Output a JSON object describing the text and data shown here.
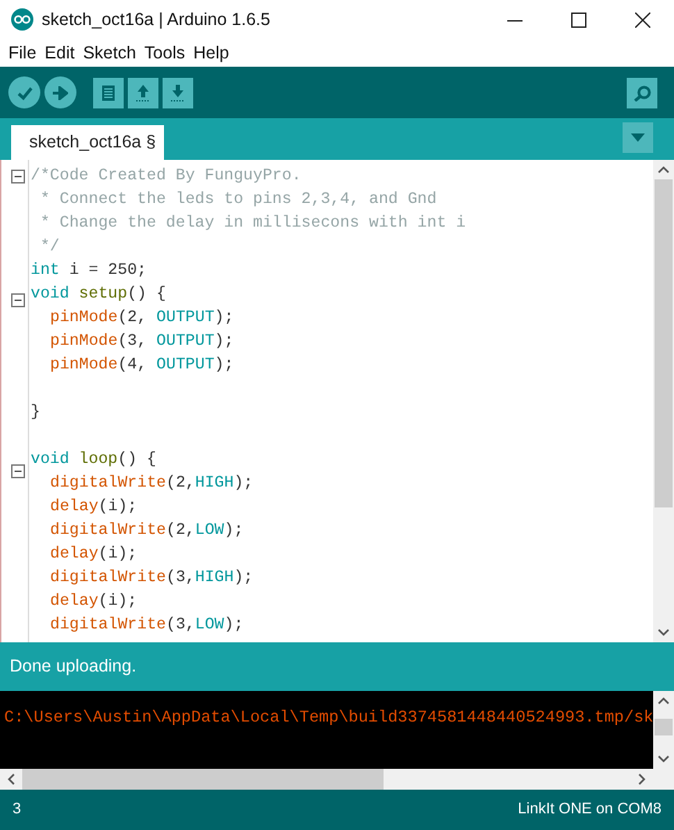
{
  "window": {
    "title": "sketch_oct16a | Arduino 1.6.5"
  },
  "menu": [
    "File",
    "Edit",
    "Sketch",
    "Tools",
    "Help"
  ],
  "tabs": [
    {
      "label": "sketch_oct16a §",
      "selected": true
    }
  ],
  "code_lines": [
    {
      "fold": true,
      "tokens": [
        {
          "text": "/*Code Created By FunguyPro.",
          "kind": "comment"
        }
      ]
    },
    {
      "fold": false,
      "tokens": [
        {
          "text": " * Connect the leds to pins 2,3,4, and Gnd",
          "kind": "comment"
        }
      ]
    },
    {
      "fold": false,
      "tokens": [
        {
          "text": " * Change the delay in millisecons with int i",
          "kind": "comment"
        }
      ]
    },
    {
      "fold": false,
      "tokens": [
        {
          "text": " */",
          "kind": "comment"
        }
      ]
    },
    {
      "fold": false,
      "tokens": [
        {
          "text": "int",
          "kind": "type"
        },
        {
          "text": " i = 250;",
          "kind": "plain"
        }
      ]
    },
    {
      "fold": true,
      "tokens": [
        {
          "text": "void ",
          "kind": "type"
        },
        {
          "text": "setup",
          "kind": "name"
        },
        {
          "text": "() {",
          "kind": "plain"
        }
      ],
      "children": [
        {
          "fold": false,
          "tokens": [
            {
              "text": "pinMode",
              "kind": "func"
            },
            {
              "text": "(2, ",
              "kind": "plain"
            },
            {
              "text": "OUTPUT",
              "kind": "const"
            },
            {
              "text": ");",
              "kind": "plain"
            }
          ]
        },
        {
          "fold": false,
          "tokens": [
            {
              "text": "pinMode",
              "kind": "func"
            },
            {
              "text": "(3, ",
              "kind": "plain"
            },
            {
              "text": "OUTPUT",
              "kind": "const"
            },
            {
              "text": ");",
              "kind": "plain"
            }
          ]
        },
        {
          "fold": false,
          "tokens": [
            {
              "text": "pinMode",
              "kind": "func"
            },
            {
              "text": "(4, ",
              "kind": "plain"
            },
            {
              "text": "OUTPUT",
              "kind": "const"
            },
            {
              "text": ");",
              "kind": "plain"
            }
          ]
        },
        {
          "fold": false
        }
      ]
    },
    {
      "fold": false,
      "tokens": [
        {
          "text": "}",
          "kind": "plain"
        }
      ]
    },
    {
      "fold": false
    },
    {
      "fold": true,
      "tokens": [
        {
          "text": "void ",
          "kind": "type"
        },
        {
          "text": "loop",
          "kind": "name"
        },
        {
          "text": "() {",
          "kind": "plain"
        }
      ],
      "children": [
        {
          "fold": false,
          "tokens": [
            {
              "text": "digitalWrite",
              "kind": "func"
            },
            {
              "text": "(2,",
              "kind": "plain"
            },
            {
              "text": "HIGH",
              "kind": "const"
            },
            {
              "text": ");",
              "kind": "plain"
            }
          ]
        },
        {
          "fold": false,
          "tokens": [
            {
              "text": "delay",
              "kind": "func"
            },
            {
              "text": "(i);",
              "kind": "plain"
            }
          ]
        },
        {
          "fold": false,
          "tokens": [
            {
              "text": "digitalWrite",
              "kind": "func"
            },
            {
              "text": "(2,",
              "kind": "plain"
            },
            {
              "text": "LOW",
              "kind": "const"
            },
            {
              "text": ");",
              "kind": "plain"
            }
          ]
        },
        {
          "fold": false,
          "tokens": [
            {
              "text": "delay",
              "kind": "func"
            },
            {
              "text": "(i);",
              "kind": "plain"
            }
          ]
        },
        {
          "fold": false,
          "tokens": [
            {
              "text": "digitalWrite",
              "kind": "func"
            },
            {
              "text": "(3,",
              "kind": "plain"
            },
            {
              "text": "HIGH",
              "kind": "const"
            },
            {
              "text": ");",
              "kind": "plain"
            }
          ]
        },
        {
          "fold": false,
          "tokens": [
            {
              "text": "delay",
              "kind": "func"
            },
            {
              "text": "(i);",
              "kind": "plain"
            }
          ]
        },
        {
          "fold": false,
          "tokens": [
            {
              "text": "digitalWrite",
              "kind": "func"
            },
            {
              "text": "(3,",
              "kind": "plain"
            },
            {
              "text": "LOW",
              "kind": "const"
            },
            {
              "text": ");",
              "kind": "plain"
            }
          ]
        }
      ]
    }
  ],
  "message": "Done uploading.",
  "console_lines": [
    "C:\\Users\\Austin\\AppData\\Local\\Temp\\build3374581448440524993.tmp/sk"
  ],
  "status_bar": {
    "line": "3",
    "board": "LinkIt ONE on COM8"
  }
}
